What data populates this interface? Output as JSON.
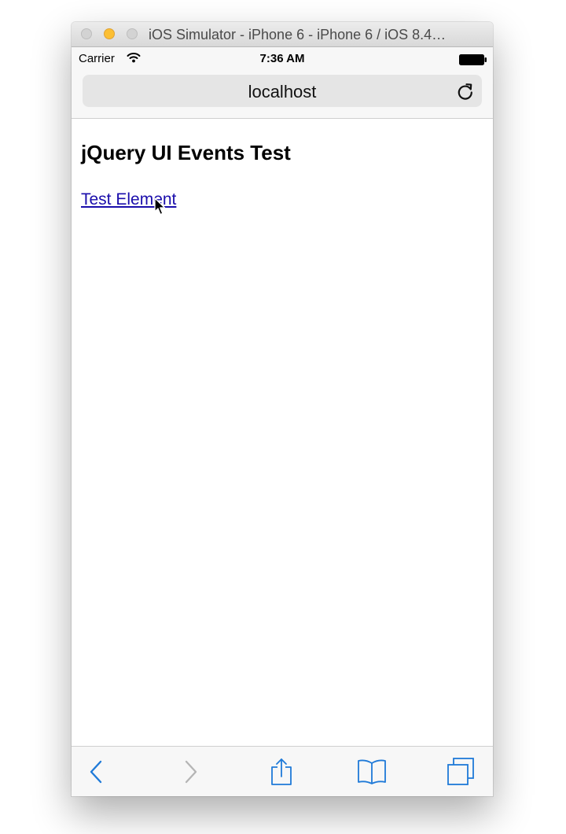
{
  "window": {
    "title": "iOS Simulator - iPhone 6 - iPhone 6 / iOS 8.4…"
  },
  "status_bar": {
    "carrier": "Carrier",
    "time": "7:36 AM",
    "wifi_icon": "wifi-icon",
    "battery_icon": "battery-icon"
  },
  "navbar": {
    "address": "localhost",
    "reload_icon": "reload-icon"
  },
  "page": {
    "heading": "jQuery UI Events Test",
    "link_text": "Test Element"
  },
  "toolbar": {
    "icons": [
      "back-icon",
      "forward-icon",
      "share-icon",
      "bookmarks-icon",
      "tabs-icon"
    ]
  },
  "colors": {
    "ios_blue": "#1f7ad8",
    "disabled_gray": "#b5b5b5",
    "link_color": "#1a0dab",
    "minimize_yellow": "#fcbf33"
  }
}
